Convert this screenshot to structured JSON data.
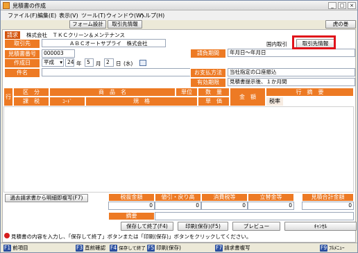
{
  "window": {
    "title": "見積書の作成",
    "controls": [
      "_",
      "□",
      "×"
    ]
  },
  "menu": [
    "ファイル(F)",
    "編集(E)",
    "表示(V)",
    "ツール(T)",
    "ウィンドウ(W)",
    "ヘルプ(H)"
  ],
  "toolbar": {
    "form_design": "フォーム設計",
    "customer_info": "取引先情報",
    "tora": "虎の巻"
  },
  "header": {
    "billing_label": "請求",
    "billing_company": "株式会社　ＴＫＣクリーン＆メンテナンス",
    "customer_label": "取引先",
    "customer_name": "ＡＢＣオートサプライ　株式会社",
    "domestic_label": "国内取引",
    "customer_info_btn": "取引先情報",
    "estimate_no_label": "見積書番号",
    "estimate_no": "000003",
    "date_label": "作成日",
    "era": "平成",
    "year": "24",
    "year_unit": "年",
    "month": "5",
    "month_unit": "月",
    "day": "2",
    "day_unit": "日",
    "weekday": "(水)",
    "subject_label": "件名",
    "subject": "",
    "period_label": "請負期間",
    "period": "年月日～年月日",
    "payment_label": "お支払方法",
    "payment": "当社指定の口座振込",
    "valid_label": "有効期限",
    "valid": "見積書提示後、１か月間"
  },
  "table": {
    "row_label": "行",
    "col_category": "区　分",
    "col_product": "商　品　名",
    "col_unit": "単位",
    "col_qty": "数　量",
    "col_summary": "行　摘　要",
    "col_amount": "金　額",
    "col_tax_class": "課　税",
    "col_code": "ｺｰﾄﾞ",
    "col_spec": "規　格",
    "col_unit_price": "単　価",
    "col_tax_rate": "税率"
  },
  "totals": {
    "copy_btn": "過去請求書から明細即複写(F7)",
    "tax_amount_label": "税抜金額",
    "tax_amount": "0",
    "discount_label": "値引・戻り高",
    "discount": "0",
    "consumption_label": "消費税等",
    "consumption": "0",
    "advance_label": "立替金等",
    "advance": "0",
    "total_label": "見積合計金額",
    "total": "0",
    "memo_label": "摘要"
  },
  "actions": {
    "save_close": "保存して終了(F4)",
    "print_save": "印刷(保存)(F5)",
    "preview": "プレビュー",
    "cancel": "ｷｬﾝｾﾙ"
  },
  "status": "見積書の内容を入力し、「保存して終了」ボタンまたは「印刷(保存)」ボタンをクリックしてください。",
  "fkeys": [
    {
      "key": "F1",
      "label": "前項目"
    },
    {
      "key": "F3",
      "label": "直前確認"
    },
    {
      "key": "F4",
      "label": "保存して終了"
    },
    {
      "key": "F5",
      "label": "印刷(保存)"
    },
    {
      "key": "F7",
      "label": "請求書複写"
    },
    {
      "key": "F9",
      "label": "ﾌﾙﾒﾆｭｰ"
    }
  ]
}
